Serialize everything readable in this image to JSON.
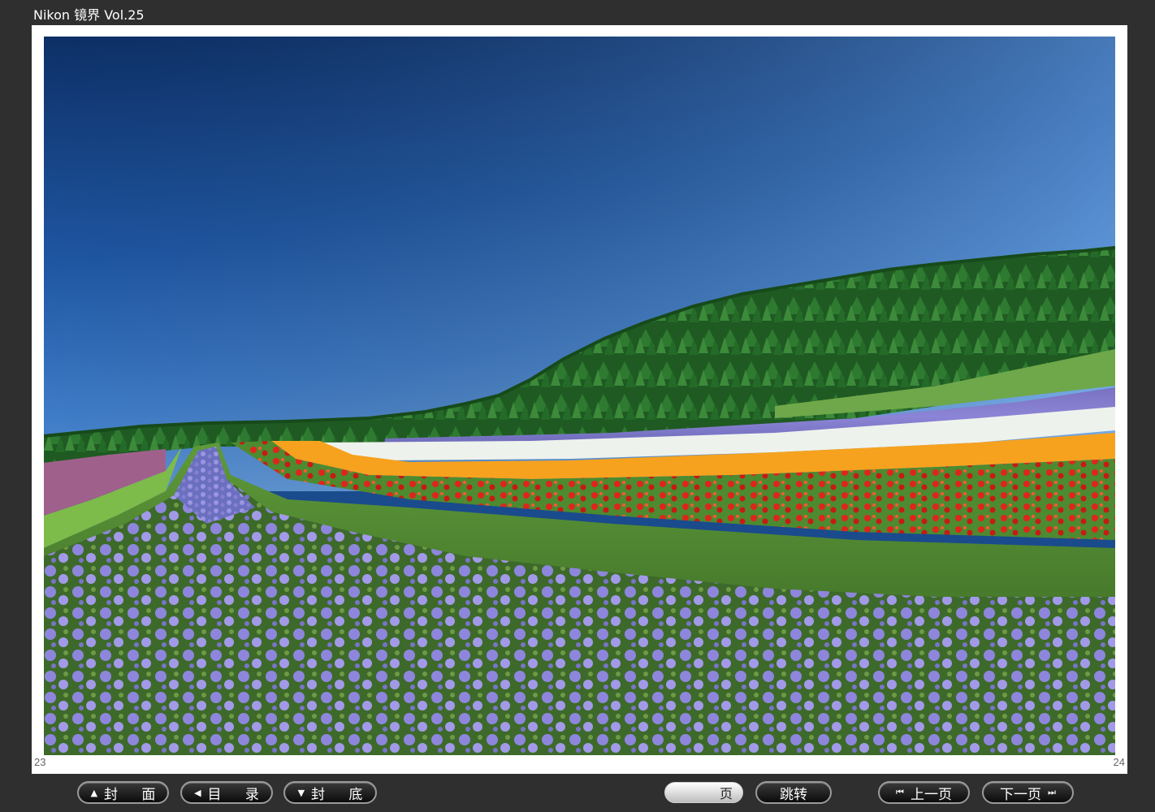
{
  "window": {
    "title": "Nikon 镜界 Vol.25"
  },
  "spread": {
    "left_page_number": "23",
    "right_page_number": "24",
    "photo_description_icon": "landscape-photo"
  },
  "toolbar": {
    "cover_label": "封 面",
    "toc_label": "目 录",
    "back_cover_label": "封 底",
    "page_suffix": "页",
    "page_input_value": "",
    "jump_label": "跳转",
    "prev_label": "上一页",
    "next_label": "下一页",
    "icons": {
      "cover": "triangle-up-icon",
      "toc": "triangle-left-icon",
      "back_cover": "triangle-down-icon",
      "prev": "skip-back-icon",
      "next": "skip-forward-icon"
    }
  },
  "colors": {
    "background": "#2f2f2f",
    "page": "#ffffff",
    "button_border": "#9a9a9a"
  }
}
